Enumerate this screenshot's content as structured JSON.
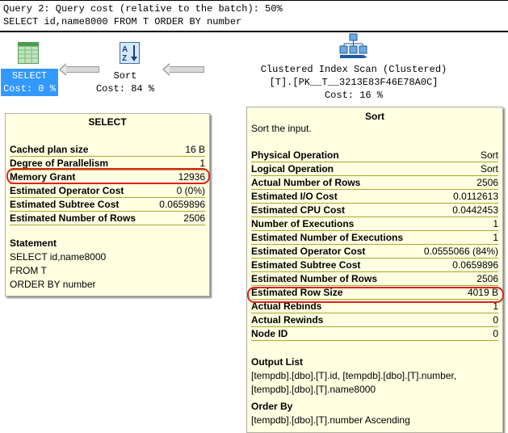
{
  "header": {
    "line1": "Query 2: Query cost (relative to the batch): 50%",
    "line2": "SELECT id,name8000 FROM T ORDER BY number"
  },
  "plan": {
    "select": {
      "label": "SELECT",
      "cost": "Cost: 0 %",
      "icon": "select-result-icon",
      "highlight": "#3399ff"
    },
    "sort": {
      "label": "Sort",
      "cost": "Cost: 84 %",
      "icon": "sort-az-icon"
    },
    "scan": {
      "label": "Clustered Index Scan (Clustered)",
      "object": "[T].[PK__T__3213E83F46E78A0C]",
      "cost": "Cost: 16 %",
      "icon": "clustered-index-scan-icon"
    }
  },
  "select_tooltip": {
    "title": "SELECT",
    "rows": [
      {
        "k": "Cached plan size",
        "v": "16 B"
      },
      {
        "k": "Degree of Parallelism",
        "v": "1"
      },
      {
        "k": "Memory Grant",
        "v": "12936"
      },
      {
        "k": "Estimated Operator Cost",
        "v": "0 (0%)"
      },
      {
        "k": "Estimated Subtree Cost",
        "v": "0.0659896"
      },
      {
        "k": "Estimated Number of Rows",
        "v": "2506"
      }
    ],
    "statement_label": "Statement",
    "statement": [
      "SELECT id,name8000",
      "FROM T",
      "ORDER BY number"
    ]
  },
  "sort_tooltip": {
    "title": "Sort",
    "description": "Sort the input.",
    "rows": [
      {
        "k": "Physical Operation",
        "v": "Sort"
      },
      {
        "k": "Logical Operation",
        "v": "Sort"
      },
      {
        "k": "Actual Number of Rows",
        "v": "2506"
      },
      {
        "k": "Estimated I/O Cost",
        "v": "0.0112613"
      },
      {
        "k": "Estimated CPU Cost",
        "v": "0.0442453"
      },
      {
        "k": "Number of Executions",
        "v": "1"
      },
      {
        "k": "Estimated Number of Executions",
        "v": "1"
      },
      {
        "k": "Estimated Operator Cost",
        "v": "0.0555066 (84%)"
      },
      {
        "k": "Estimated Subtree Cost",
        "v": "0.0659896"
      },
      {
        "k": "Estimated Number of Rows",
        "v": "2506"
      },
      {
        "k": "Estimated Row Size",
        "v": "4019 B"
      },
      {
        "k": "Actual Rebinds",
        "v": "1"
      },
      {
        "k": "Actual Rewinds",
        "v": "0"
      },
      {
        "k": "Node ID",
        "v": "0"
      }
    ],
    "output_label": "Output List",
    "output": [
      "[tempdb].[dbo].[T].id, [tempdb].[dbo].[T].number,",
      "[tempdb].[dbo].[T].name8000"
    ],
    "order_label": "Order By",
    "order": "[tempdb].[dbo].[T].number Ascending"
  }
}
